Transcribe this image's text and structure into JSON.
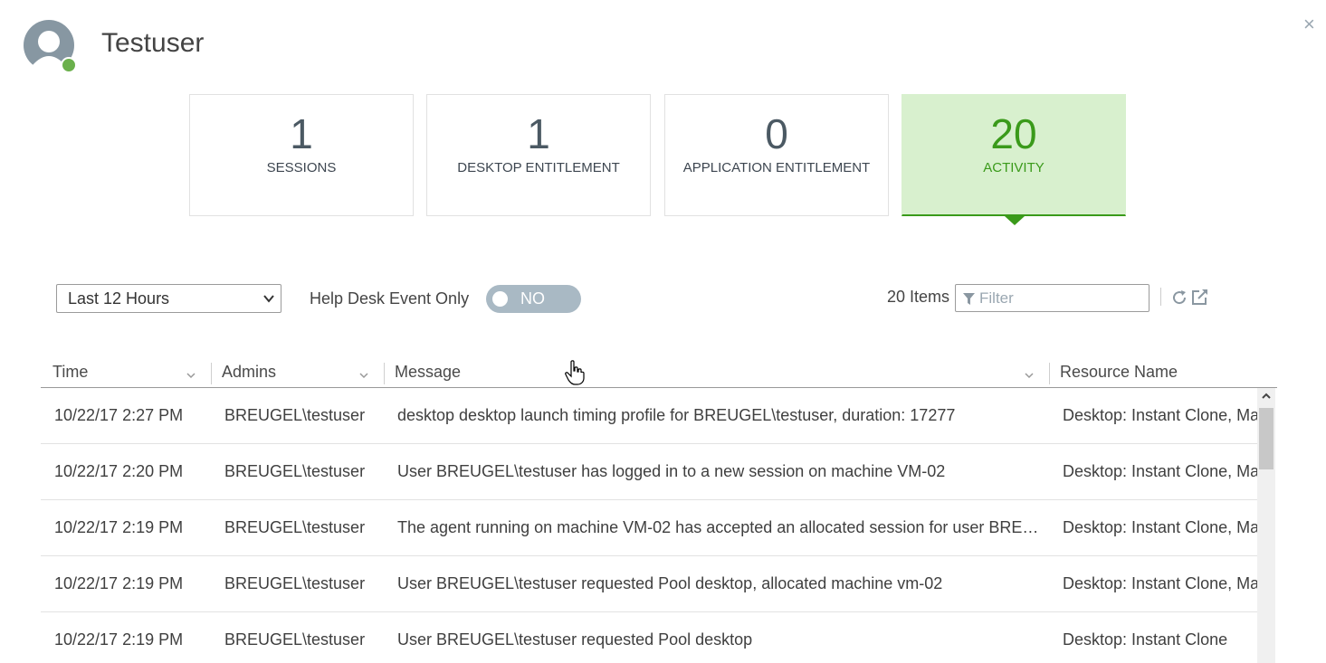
{
  "header": {
    "user_name": "Testuser",
    "close_glyph": "×"
  },
  "cards": [
    {
      "number": "1",
      "label": "SESSIONS"
    },
    {
      "number": "1",
      "label": "DESKTOP ENTITLEMENT"
    },
    {
      "number": "0",
      "label": "APPLICATION ENTITLEMENT"
    },
    {
      "number": "20",
      "label": "ACTIVITY"
    }
  ],
  "toolbar": {
    "time_range": "Last 12 Hours",
    "help_desk_label": "Help Desk Event Only",
    "toggle_state": "NO",
    "items_count": "20 Items",
    "filter_placeholder": "Filter"
  },
  "table": {
    "columns": [
      "Time",
      "Admins",
      "Message",
      "Resource Name"
    ],
    "rows": [
      {
        "time": "10/22/17 2:27 PM",
        "admin": "BREUGEL\\testuser",
        "message": "desktop desktop launch timing profile for BREUGEL\\testuser, duration: 17277",
        "resource": "Desktop: Instant Clone, Ma"
      },
      {
        "time": "10/22/17 2:20 PM",
        "admin": "BREUGEL\\testuser",
        "message": "User BREUGEL\\testuser has logged in to a new session on machine VM-02",
        "resource": "Desktop: Instant Clone, Ma"
      },
      {
        "time": "10/22/17 2:19 PM",
        "admin": "BREUGEL\\testuser",
        "message": "The agent running on machine VM-02 has accepted an allocated session for user BRE…",
        "resource": "Desktop: Instant Clone, Ma"
      },
      {
        "time": "10/22/17 2:19 PM",
        "admin": "BREUGEL\\testuser",
        "message": "User BREUGEL\\testuser requested Pool desktop, allocated machine vm-02",
        "resource": "Desktop: Instant Clone, Ma"
      },
      {
        "time": "10/22/17 2:19 PM",
        "admin": "BREUGEL\\testuser",
        "message": "User BREUGEL\\testuser requested Pool desktop",
        "resource": "Desktop: Instant Clone"
      }
    ]
  },
  "colors": {
    "accent_green": "#3a9a1a",
    "active_card_bg": "#d8f0ce",
    "toggle_bg": "#a9b9c4"
  },
  "icons": [
    "user-avatar-icon",
    "online-status-icon",
    "close-icon",
    "chevron-down-icon",
    "filter-icon",
    "refresh-icon",
    "export-icon",
    "sort-chevron-icon",
    "scroll-up-icon",
    "hand-cursor-icon"
  ]
}
